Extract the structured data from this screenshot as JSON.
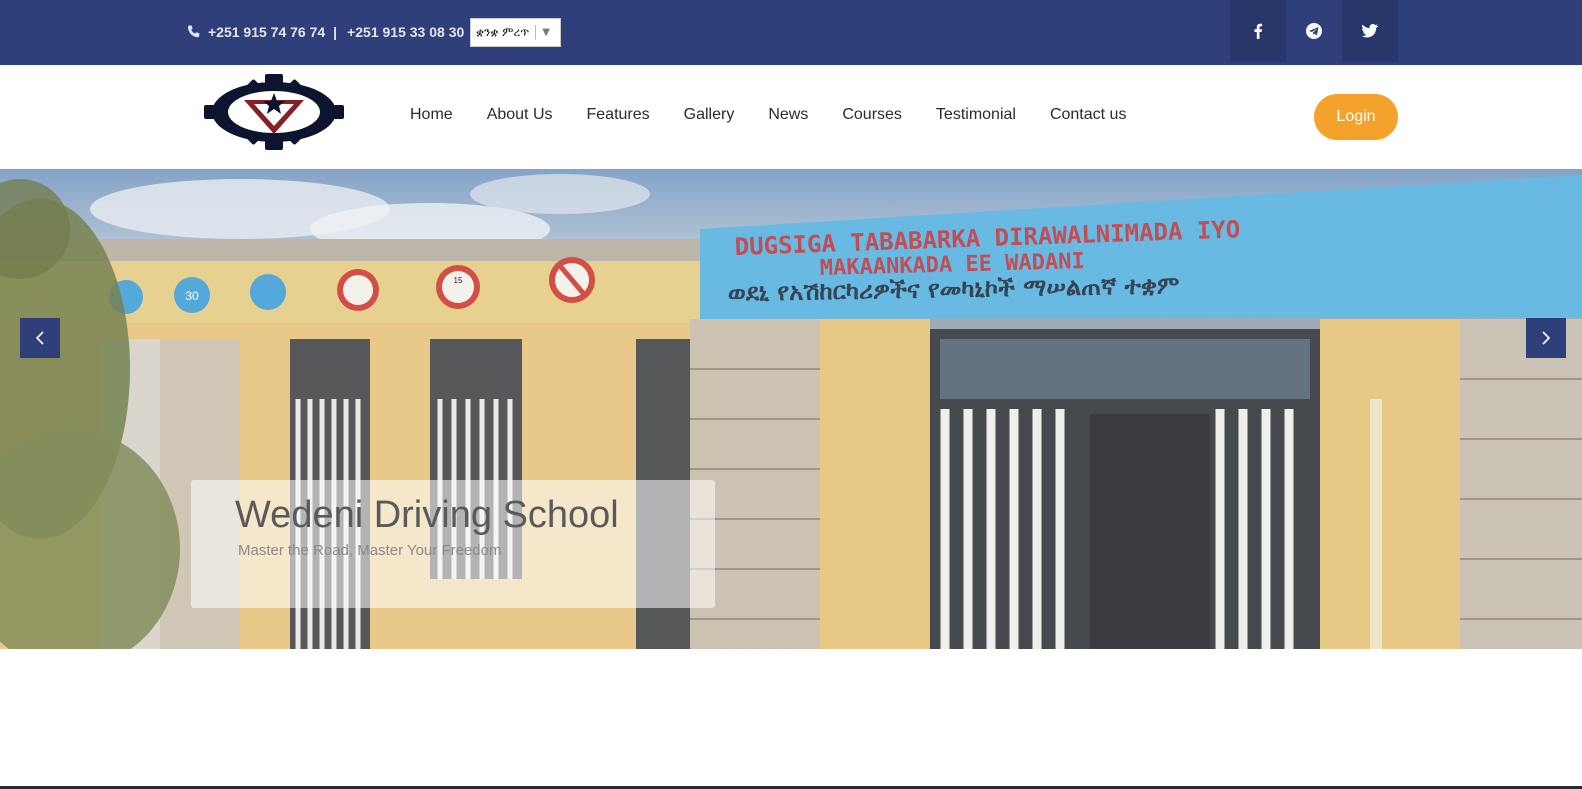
{
  "topbar": {
    "phone_1": "+251 915 74 76 74",
    "separator": "|",
    "phone_2": "+251 915 33 08 30",
    "language": {
      "selected": "ቋንቋ ምረጥ",
      "caret": "▼"
    },
    "social": [
      "facebook-icon",
      "telegram-icon",
      "twitter-icon"
    ]
  },
  "nav": {
    "items": [
      "Home",
      "About Us",
      "Features",
      "Gallery",
      "News",
      "Courses",
      "Testimonial",
      "Contact us"
    ],
    "login_label": "Login"
  },
  "hero": {
    "title": "Wedeni Driving School",
    "subtitle": "Master the Road, Master Your Freedom",
    "sign_line_1": "DUGSIGA TABABARKA DIRAWALNIMADA IYO",
    "sign_line_2": "MAKAANKADA EE WADANI",
    "sign_line_3": "ወደኒ የአሽከርካሪዎችና የመካኒኮች ማሠልጠኛ ተቋም",
    "road_sign_text": [
      "30",
      "15"
    ]
  },
  "colors": {
    "topbar_bg": "#2f3f7a",
    "accent": "#f5a22c",
    "nav_text": "#2b2b2b"
  }
}
